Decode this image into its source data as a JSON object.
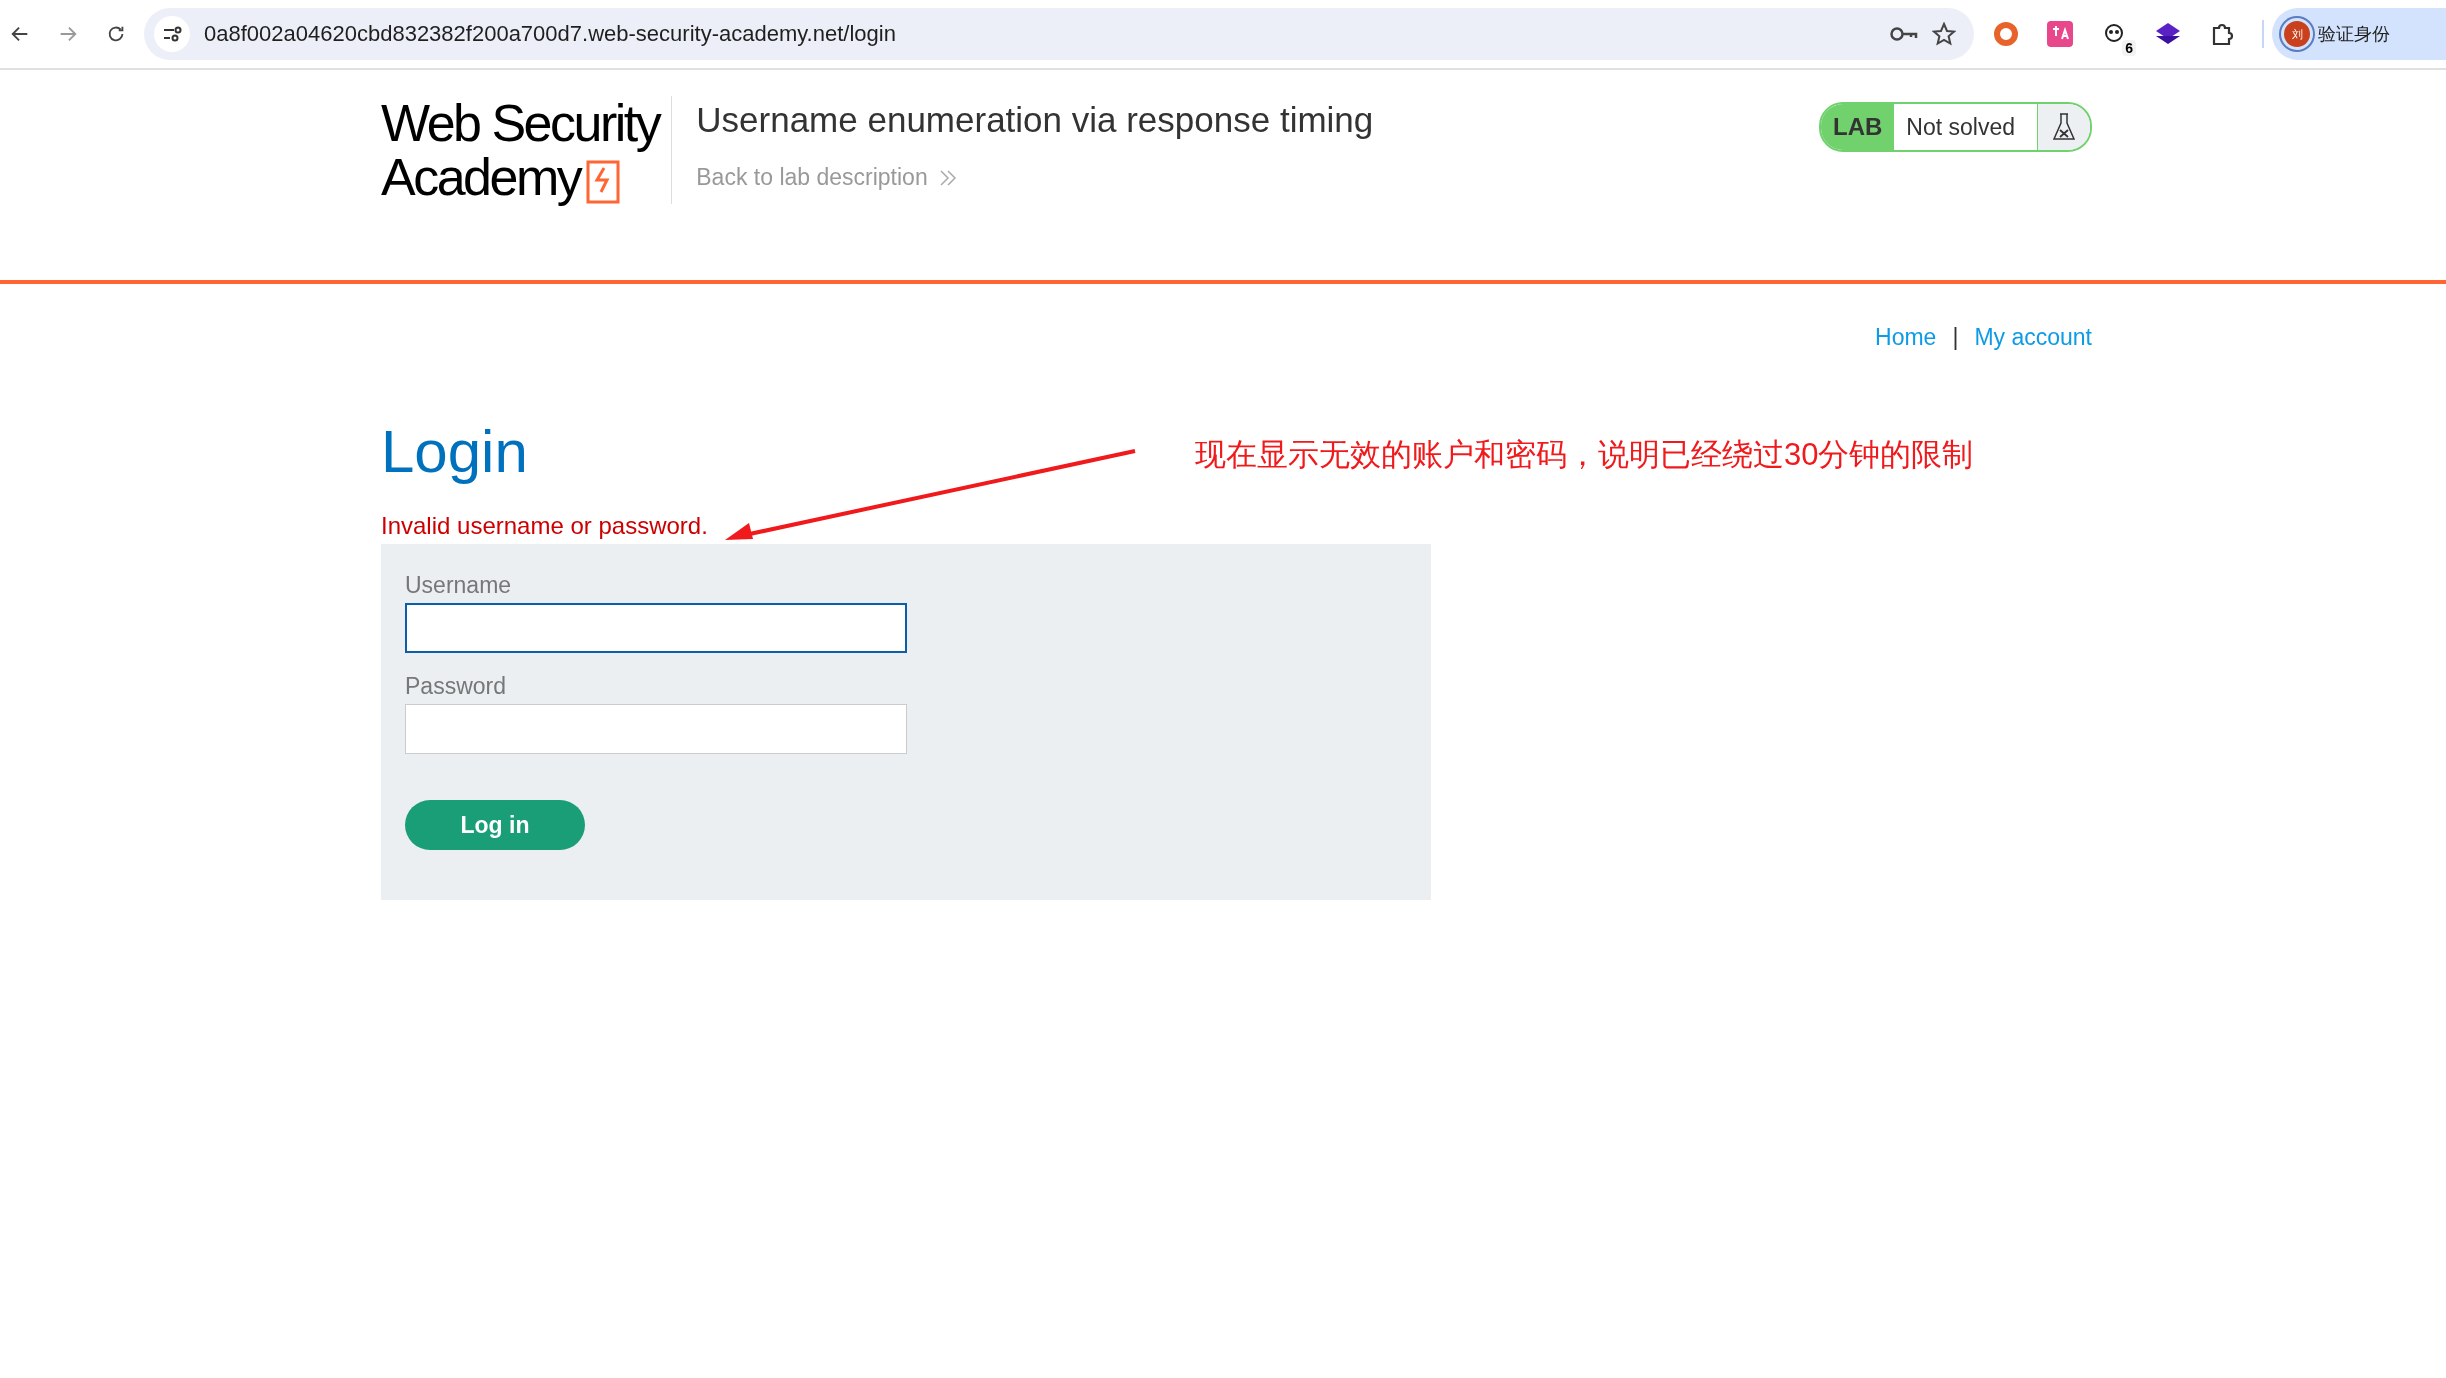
{
  "browser": {
    "url": "0a8f002a04620cbd832382f200a700d7.web-security-academy.net/login",
    "extension_badge": "6",
    "profile": {
      "avatar": "刘",
      "label": "验证身份"
    }
  },
  "header": {
    "logo": {
      "line_1": "Web Security",
      "line_2": "Academy"
    },
    "title": "Username enumeration via response timing",
    "back_link": "Back to lab description",
    "lab_status": {
      "badge": "LAB",
      "status": "Not solved",
      "solved": false
    }
  },
  "nav": {
    "links": [
      "Home",
      "My account"
    ],
    "separator": "|"
  },
  "login": {
    "title": "Login",
    "error": "Invalid username or password.",
    "fields": [
      {
        "label": "Username",
        "focused": true
      },
      {
        "label": "Password",
        "focused": false
      }
    ],
    "button": "Log in"
  },
  "annotation": {
    "text": "现在显示无效的账户和密码，说明已经绕过30分钟的限制"
  }
}
